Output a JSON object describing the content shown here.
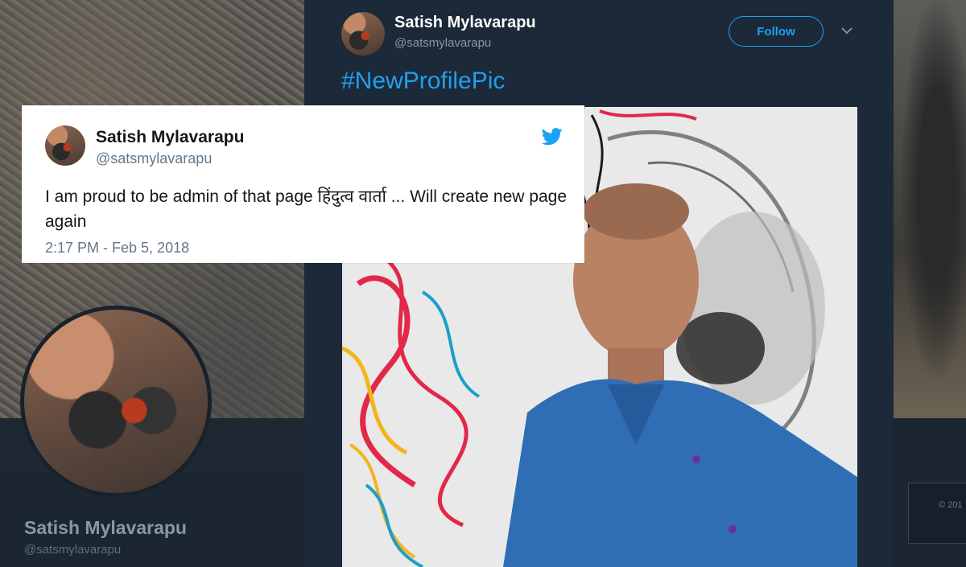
{
  "background_profile": {
    "name": "Satish Mylavarapu",
    "handle": "@satsmylavarapu",
    "copyright_fragment": "© 201"
  },
  "modal_tweet": {
    "author_name": "Satish Mylavarapu",
    "author_handle": "@satsmylavarapu",
    "follow_label": "Follow",
    "hashtag": "#NewProfilePic",
    "accent_color": "#1da1f2"
  },
  "quoted_card": {
    "author_name": "Satish Mylavarapu",
    "author_handle": "@satsmylavarapu",
    "text": "I am proud to be admin of that page हिंदुत्व वार्ता ... Will create new page again",
    "timestamp": "2:17 PM - Feb 5, 2018",
    "brand_icon": "twitter-bird-icon"
  }
}
